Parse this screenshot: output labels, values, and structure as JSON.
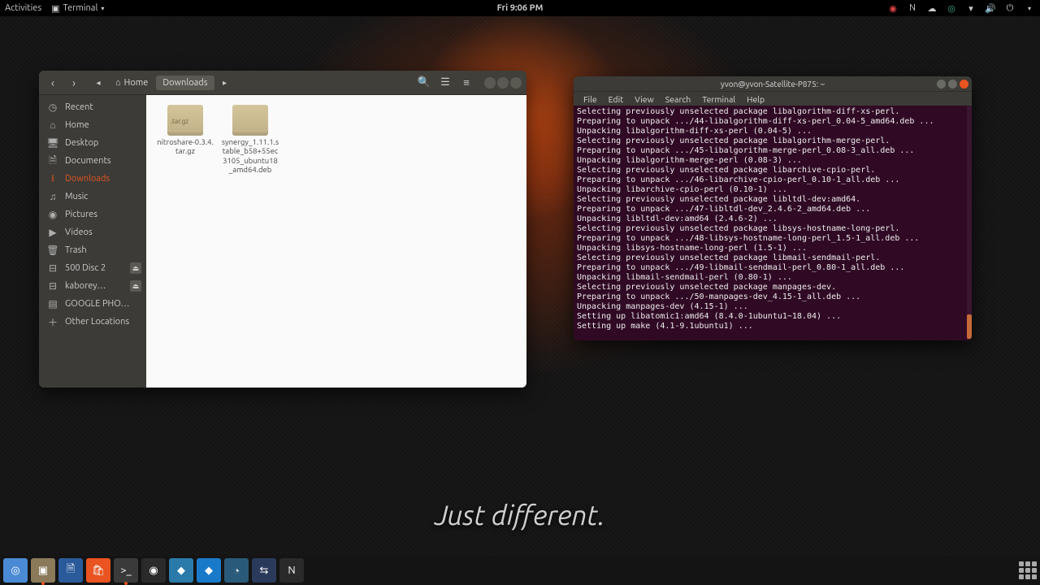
{
  "topbar": {
    "activities": "Activities",
    "app_label": "Terminal",
    "clock": "Fri  9:06 PM"
  },
  "wallpaper_tagline": "Just different.",
  "fm": {
    "path_home": "Home",
    "path_current": "Downloads",
    "sidebar": [
      {
        "icon": "◷",
        "label": "Recent",
        "name": "recent"
      },
      {
        "icon": "⌂",
        "label": "Home",
        "name": "home"
      },
      {
        "icon": "🖥",
        "label": "Desktop",
        "name": "desktop"
      },
      {
        "icon": "🗎",
        "label": "Documents",
        "name": "documents"
      },
      {
        "icon": "⭳",
        "label": "Downloads",
        "name": "downloads",
        "active": true
      },
      {
        "icon": "♫",
        "label": "Music",
        "name": "music"
      },
      {
        "icon": "◉",
        "label": "Pictures",
        "name": "pictures"
      },
      {
        "icon": "▶",
        "label": "Videos",
        "name": "videos"
      },
      {
        "icon": "🗑",
        "label": "Trash",
        "name": "trash"
      },
      {
        "icon": "⊟",
        "label": "500 Disc 2",
        "name": "disk-500",
        "eject": true
      },
      {
        "icon": "⊟",
        "label": "kaborey…",
        "name": "disk-kab",
        "eject": true
      },
      {
        "icon": "▤",
        "label": "GOOGLE PHO…",
        "name": "google-photos"
      },
      {
        "icon": "＋",
        "label": "Other Locations",
        "name": "other-locations"
      }
    ],
    "files": [
      {
        "label": "nitroshare-0.3.4.tar.gz",
        "tar": true
      },
      {
        "label": "synergy_1.11.1.stable_b58+55ec3105_ubuntu18_amd64.deb",
        "tar": false
      }
    ]
  },
  "terminal": {
    "title": "yvon@yvon-Satellite-P875: ~",
    "menu": [
      "File",
      "Edit",
      "View",
      "Search",
      "Terminal",
      "Help"
    ],
    "lines": [
      "Selecting previously unselected package libalgorithm-diff-xs-perl.",
      "Preparing to unpack .../44-libalgorithm-diff-xs-perl_0.04-5_amd64.deb ...",
      "Unpacking libalgorithm-diff-xs-perl (0.04-5) ...",
      "Selecting previously unselected package libalgorithm-merge-perl.",
      "Preparing to unpack .../45-libalgorithm-merge-perl_0.08-3_all.deb ...",
      "Unpacking libalgorithm-merge-perl (0.08-3) ...",
      "Selecting previously unselected package libarchive-cpio-perl.",
      "Preparing to unpack .../46-libarchive-cpio-perl_0.10-1_all.deb ...",
      "Unpacking libarchive-cpio-perl (0.10-1) ...",
      "Selecting previously unselected package libltdl-dev:amd64.",
      "Preparing to unpack .../47-libltdl-dev_2.4.6-2_amd64.deb ...",
      "Unpacking libltdl-dev:amd64 (2.4.6-2) ...",
      "Selecting previously unselected package libsys-hostname-long-perl.",
      "Preparing to unpack .../48-libsys-hostname-long-perl_1.5-1_all.deb ...",
      "Unpacking libsys-hostname-long-perl (1.5-1) ...",
      "Selecting previously unselected package libmail-sendmail-perl.",
      "Preparing to unpack .../49-libmail-sendmail-perl_0.80-1_all.deb ...",
      "Unpacking libmail-sendmail-perl (0.80-1) ...",
      "Selecting previously unselected package manpages-dev.",
      "Preparing to unpack .../50-manpages-dev_4.15-1_all.deb ...",
      "Unpacking manpages-dev (4.15-1) ...",
      "Setting up libatomic1:amd64 (8.4.0-1ubuntu1~18.04) ...",
      "Setting up make (4.1-9.1ubuntu1) ..."
    ]
  },
  "dock": [
    {
      "name": "chromium",
      "glyph": "◎",
      "bg": "#4a8ad4"
    },
    {
      "name": "files",
      "glyph": "▣",
      "bg": "#8a7a5a",
      "running": true
    },
    {
      "name": "libreoffice",
      "glyph": "🗎",
      "bg": "#2a5a9a"
    },
    {
      "name": "software",
      "glyph": "🛍",
      "bg": "#e95420"
    },
    {
      "name": "terminal",
      "glyph": ">_",
      "bg": "#3a3a3a",
      "running": true
    },
    {
      "name": "obs",
      "glyph": "◉",
      "bg": "#2a2a2a"
    },
    {
      "name": "rambox",
      "glyph": "◆",
      "bg": "#2a7aaa"
    },
    {
      "name": "kodi",
      "glyph": "◆",
      "bg": "#1a7aca"
    },
    {
      "name": "clock",
      "glyph": "◔",
      "bg": "#2a5a7a"
    },
    {
      "name": "bt",
      "glyph": "⇆",
      "bg": "#2a3a5a"
    },
    {
      "name": "n-app",
      "glyph": "N",
      "bg": "#2a2a2a"
    }
  ]
}
